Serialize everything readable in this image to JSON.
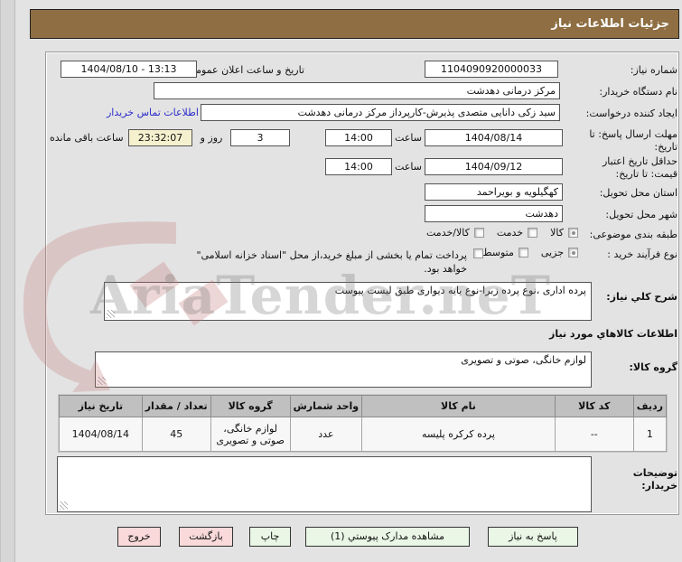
{
  "title": "جزئیات اطلاعات نیاز",
  "watermark": {
    "text": "AriaTender.neT"
  },
  "fields": {
    "need_number": {
      "label": "شماره نیاز:",
      "value": "1104090920000033"
    },
    "announce": {
      "label": "تاریخ و ساعت اعلان عمومی:",
      "value": "1404/08/10 - 13:13"
    },
    "buyer_org": {
      "label": "نام دستگاه خریدار:",
      "value": "مرکز درمانی دهدشت"
    },
    "creator": {
      "label": "ایجاد کننده درخواست:",
      "value": "سید زکی دانایی متصدی پذیرش-کارپرداز مرکز درمانی دهدشت"
    },
    "contact_link": "اطلاعات تماس خریدار",
    "deadline": {
      "label": "مهلت ارسال پاسخ: تا تاریخ:",
      "date": "1404/08/14",
      "hour_label": "ساعت",
      "time": "14:00"
    },
    "remaining": {
      "days": "3",
      "conj": "روز و",
      "time": "23:32:07",
      "label": "ساعت باقی مانده"
    },
    "validity": {
      "label": "حداقل تاریخ اعتبار قیمت: تا تاریخ:",
      "date": "1404/09/12",
      "hour_label": "ساعت",
      "time": "14:00"
    },
    "province": {
      "label": "استان محل تحویل:",
      "value": "کهگیلویه و بویراحمد"
    },
    "city": {
      "label": "شهر محل تحویل:",
      "value": "دهدشت"
    },
    "classification": {
      "label": "طبقه بندی موضوعی:",
      "options": [
        {
          "label": "کالا",
          "selected": true
        },
        {
          "label": "خدمت",
          "selected": false
        },
        {
          "label": "کالا/خدمت",
          "selected": false
        }
      ]
    },
    "process": {
      "label": "نوع فرآیند خرید :",
      "options": [
        {
          "label": "جزیی",
          "selected": true
        },
        {
          "label": "متوسط",
          "selected": false
        }
      ],
      "treasury_text": "پرداخت تمام یا بخشی از مبلغ خرید،از محل \"اسناد خزانه اسلامی\" خواهد بود.",
      "treasury_checked": false
    },
    "description": {
      "label": "شرح کلي نیاز:",
      "value": "پرده اداری ،نوع پرده زبرا-نوع پایه دیواری طبق لیست پیوست"
    },
    "goods_header": "اطلاعات کالاهاي مورد نیاز",
    "goods_group": {
      "label": "گروه کالا:",
      "value": "لوازم خانگی، صوتی و تصویری"
    },
    "notes": {
      "label": "توضیحات خریدار:",
      "value": ""
    }
  },
  "table": {
    "headers": [
      "ردیف",
      "کد کالا",
      "نام کالا",
      "واحد شمارش",
      "گروه کالا",
      "تعداد / مقدار",
      "تاریخ نیاز"
    ],
    "rows": [
      [
        "1",
        "--",
        "پرده کرکره پلیسه",
        "عدد",
        "لوازم خانگی، صوتی و تصویری",
        "45",
        "1404/08/14"
      ]
    ]
  },
  "buttons": [
    {
      "label": "پاسخ به نیاز",
      "style": "green"
    },
    {
      "label": "مشاهده مدارک پیوستي (1)",
      "style": "green"
    },
    {
      "label": "چاپ",
      "style": "green"
    },
    {
      "label": "بازگشت",
      "style": "pink"
    },
    {
      "label": "خروج",
      "style": "pink"
    }
  ],
  "colors": {
    "titlebar": "#8e6e42",
    "page_bg": "#e3e3e3",
    "countdown_bg": "#f5f1cf",
    "link": "#2d2dcc",
    "table_header_bg": "#c0c0c0",
    "button_green": "#eaf7e6",
    "button_pink": "#f9d9d9"
  }
}
